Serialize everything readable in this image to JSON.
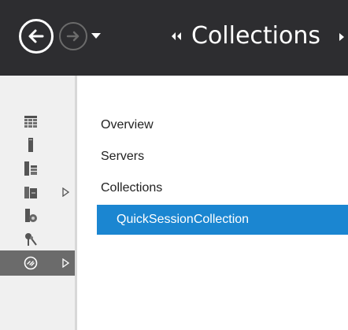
{
  "header": {
    "back_icon": "arrow-left-icon",
    "forward_icon": "arrow-right-icon",
    "dropdown_icon": "caret-down-icon",
    "breadcrumb_chevron": "double-chevron-left-icon",
    "breadcrumb_label": "Collections",
    "breadcrumb_trailing_icon": "chevron-right-icon",
    "background": "#2d2d30"
  },
  "rail": {
    "items": [
      {
        "icon": "dashboard-grid-icon"
      },
      {
        "icon": "local-server-icon"
      },
      {
        "icon": "all-servers-icon"
      },
      {
        "icon": "file-storage-icon",
        "expandable": true
      },
      {
        "icon": "iis-icon"
      },
      {
        "icon": "remote-access-icon"
      },
      {
        "icon": "remote-desktop-services-icon",
        "expandable": true,
        "selected": true
      }
    ]
  },
  "nav": {
    "items": [
      {
        "label": "Overview"
      },
      {
        "label": "Servers"
      },
      {
        "label": "Collections"
      },
      {
        "label": "QuickSessionCollection",
        "selected": true
      }
    ],
    "selected_color": "#1b86d1"
  }
}
